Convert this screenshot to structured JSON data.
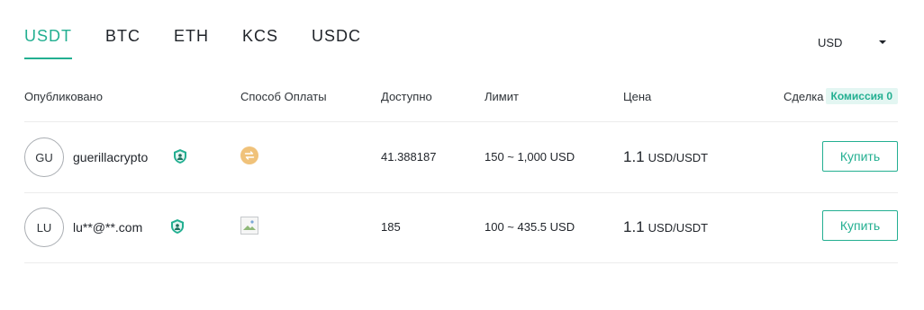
{
  "tabs": [
    {
      "label": "USDT",
      "active": true
    },
    {
      "label": "BTC",
      "active": false
    },
    {
      "label": "ETH",
      "active": false
    },
    {
      "label": "KCS",
      "active": false
    },
    {
      "label": "USDC",
      "active": false
    }
  ],
  "currency_select": {
    "value": "USD"
  },
  "table": {
    "headers": {
      "published": "Опубликовано",
      "payment": "Способ Оплаты",
      "available": "Доступно",
      "limit": "Лимит",
      "price": "Цена",
      "deal": "Сделка",
      "fee_badge": "Комиссия 0"
    },
    "rows": [
      {
        "avatar": "GU",
        "username": "guerillacrypto",
        "verified_icon": "shield-user-icon",
        "payment_icon": "bank-transfer-icon",
        "available": "41.388187",
        "limit": "150 ~ 1,000 USD",
        "price_value": "1.1",
        "price_unit": "USD/USDT",
        "action": "Купить"
      },
      {
        "avatar": "LU",
        "username": "lu**@**.com",
        "verified_icon": "shield-user-icon",
        "payment_icon": "broken-image-icon",
        "available": "185",
        "limit": "100 ~ 435.5 USD",
        "price_value": "1.1",
        "price_unit": "USD/USDT",
        "action": "Купить"
      }
    ]
  },
  "colors": {
    "accent": "#23af91",
    "fee_badge_bg": "#e3f6f2",
    "payment_icon": "#f0c27a",
    "divider": "#ececec"
  }
}
